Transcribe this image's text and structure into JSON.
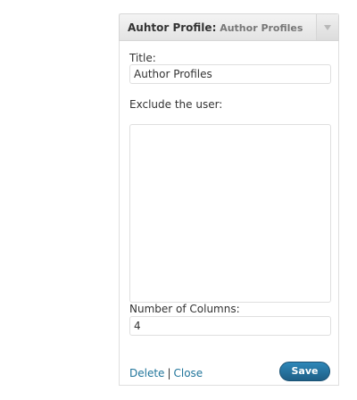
{
  "widget": {
    "title_main": "Auhtor Profile",
    "title_separator": ":",
    "title_sub": "Author Profiles",
    "toggle_icon": "triangle-down-icon"
  },
  "form": {
    "title_label": "Title:",
    "title_value": "Author Profiles",
    "exclude_label": "Exclude the user:",
    "exclude_options": [],
    "columns_label": "Number of Columns:",
    "columns_value": "4"
  },
  "actions": {
    "delete_label": "Delete",
    "separator": "|",
    "close_label": "Close",
    "save_label": "Save"
  },
  "colors": {
    "link": "#21759b",
    "save_button": "#21759b",
    "header_bg": "#e9e9e9",
    "border": "#dfdfdf"
  }
}
